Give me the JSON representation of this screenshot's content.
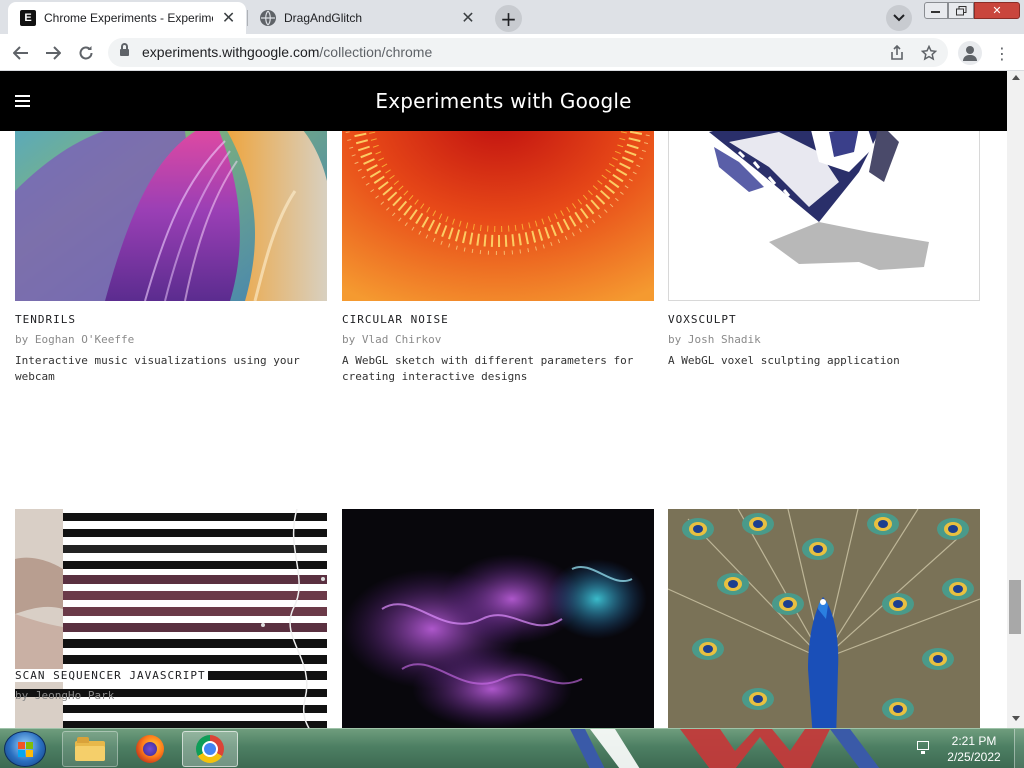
{
  "browser": {
    "tabs": [
      {
        "title": "Chrome Experiments - Experimen",
        "favicon": "e-logo-icon",
        "active": true
      },
      {
        "title": "DragAndGlitch",
        "favicon": "globe-icon",
        "active": false
      }
    ],
    "new_tab_label": "+",
    "url_host": "experiments.withgoogle.com",
    "url_path": "/collection/chrome"
  },
  "site": {
    "title": "Experiments with Google",
    "menu_icon": "hamburger-menu-icon"
  },
  "cards": [
    {
      "title": "TENDRILS",
      "author": "by Eoghan O'Keeffe",
      "description": "Interactive music visualizations using your webcam",
      "thumbnail": "tendrils-thumbnail"
    },
    {
      "title": "CIRCULAR NOISE",
      "author": "by Vlad Chirkov",
      "description": "A WebGL sketch with different parameters for creating interactive designs",
      "thumbnail": "circular-noise-thumbnail"
    },
    {
      "title": "VOXSCULPT",
      "author": "by Josh Shadik",
      "description": "A WebGL voxel sculpting application",
      "thumbnail": "voxsculpt-thumbnail"
    },
    {
      "title": "SCAN SEQUENCER JAVASCRIPT",
      "author": "by JeongHo Park",
      "description": "",
      "thumbnail": "scan-sequencer-thumbnail"
    },
    {
      "title": "",
      "author": "",
      "description": "",
      "thumbnail": "purple-smoke-thumbnail"
    },
    {
      "title": "",
      "author": "",
      "description": "",
      "thumbnail": "peacock-thumbnail"
    }
  ],
  "taskbar": {
    "time": "2:21 PM",
    "date": "2/25/2022",
    "pinned": [
      "file-explorer-icon",
      "firefox-icon",
      "chrome-icon"
    ]
  },
  "colors": {
    "header_bg": "#000000",
    "tab_strip": "#dee1e6",
    "taskbar_green": "#4d7f63"
  },
  "viewport_note": ""
}
